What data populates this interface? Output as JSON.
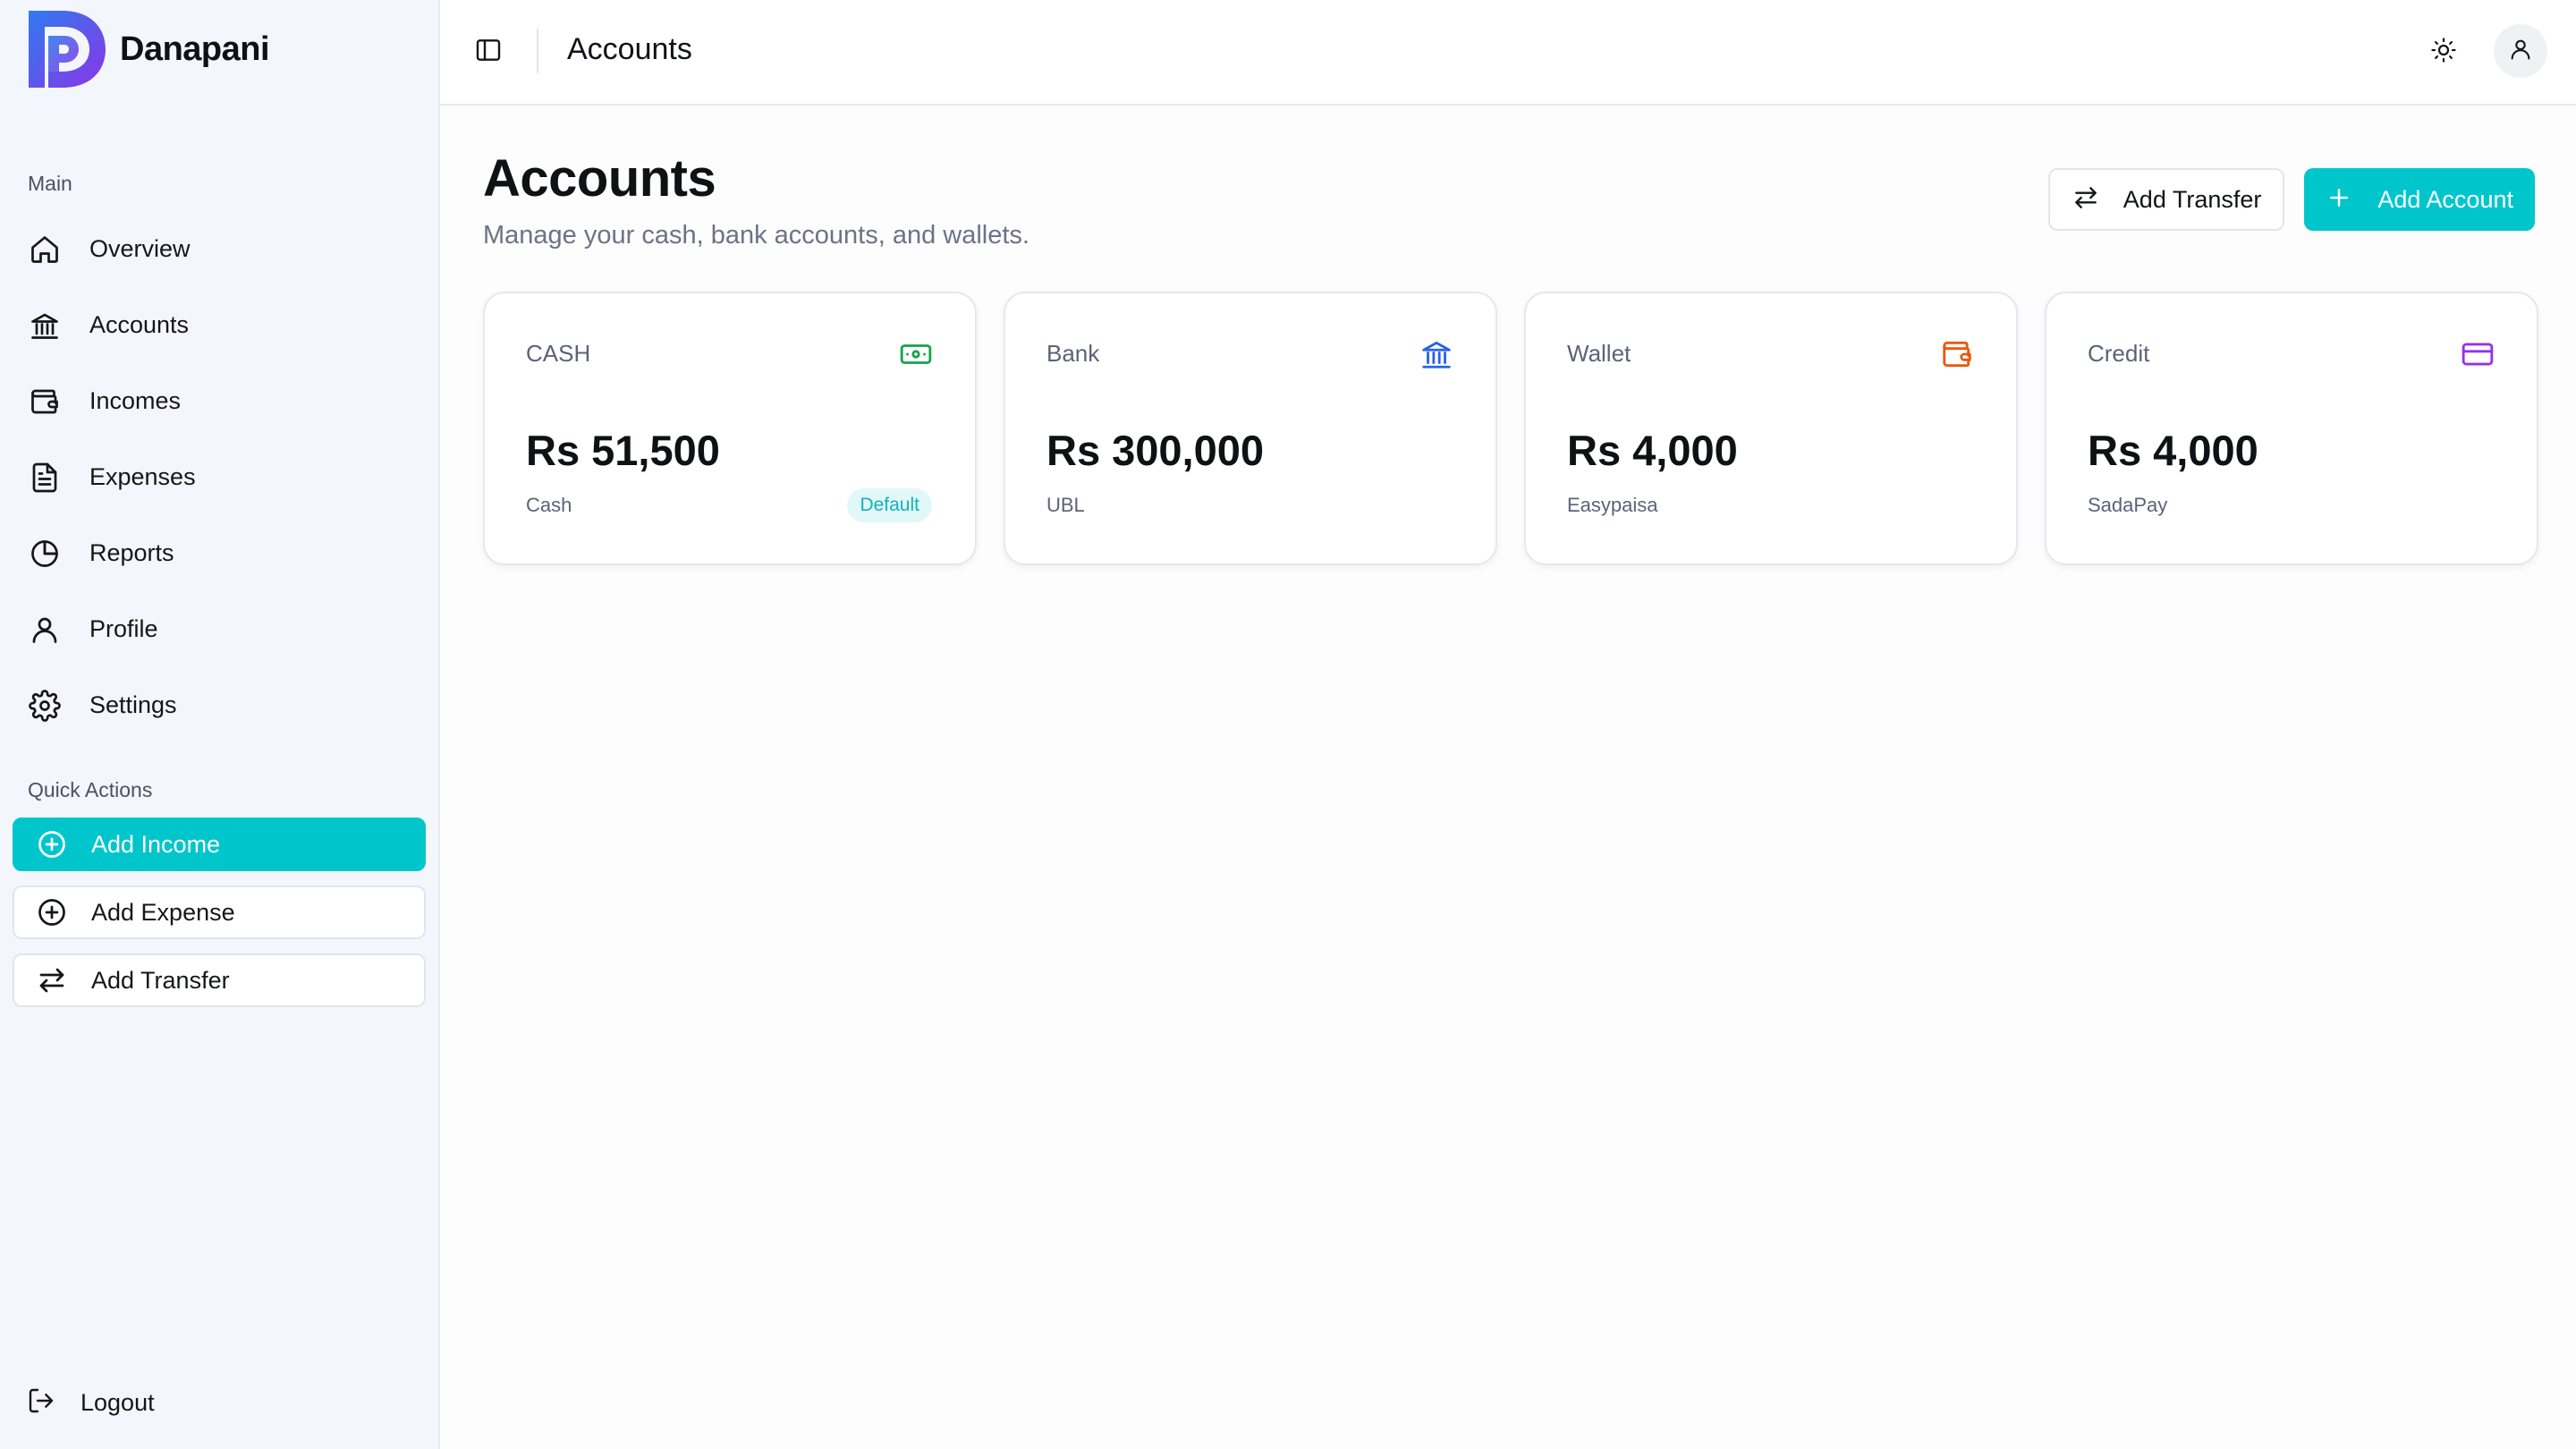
{
  "brand": {
    "name": "Danapani"
  },
  "sidebar": {
    "main_label": "Main",
    "items": [
      {
        "label": "Overview",
        "icon": "home-icon"
      },
      {
        "label": "Accounts",
        "icon": "bank-icon"
      },
      {
        "label": "Incomes",
        "icon": "wallet-icon"
      },
      {
        "label": "Expenses",
        "icon": "document-icon"
      },
      {
        "label": "Reports",
        "icon": "pie-chart-icon"
      },
      {
        "label": "Profile",
        "icon": "user-icon"
      },
      {
        "label": "Settings",
        "icon": "gear-icon"
      }
    ],
    "quick_label": "Quick Actions",
    "quick_actions": [
      {
        "label": "Add Income",
        "icon": "plus-circle-icon"
      },
      {
        "label": "Add Expense",
        "icon": "plus-circle-icon"
      },
      {
        "label": "Add Transfer",
        "icon": "transfer-icon"
      }
    ],
    "logout_label": "Logout"
  },
  "topbar": {
    "title": "Accounts"
  },
  "page": {
    "title": "Accounts",
    "subtitle": "Manage your cash, bank accounts, and wallets.",
    "add_transfer_label": "Add Transfer",
    "add_account_label": "Add Account"
  },
  "cards": [
    {
      "type": "CASH",
      "amount": "Rs 51,500",
      "name": "Cash",
      "badge": "Default",
      "icon": "cash-icon",
      "color": "#16a34a"
    },
    {
      "type": "Bank",
      "amount": "Rs 300,000",
      "name": "UBL",
      "icon": "bank-icon",
      "color": "#2563eb"
    },
    {
      "type": "Wallet",
      "amount": "Rs 4,000",
      "name": "Easypaisa",
      "icon": "wallet-icon",
      "color": "#ea580c"
    },
    {
      "type": "Credit",
      "amount": "Rs 4,000",
      "name": "SadaPay",
      "icon": "credit-card-icon",
      "color": "#9333ea"
    }
  ],
  "colors": {
    "accent": "#00c6cc",
    "sidebar_bg": "#f4f6fd"
  }
}
